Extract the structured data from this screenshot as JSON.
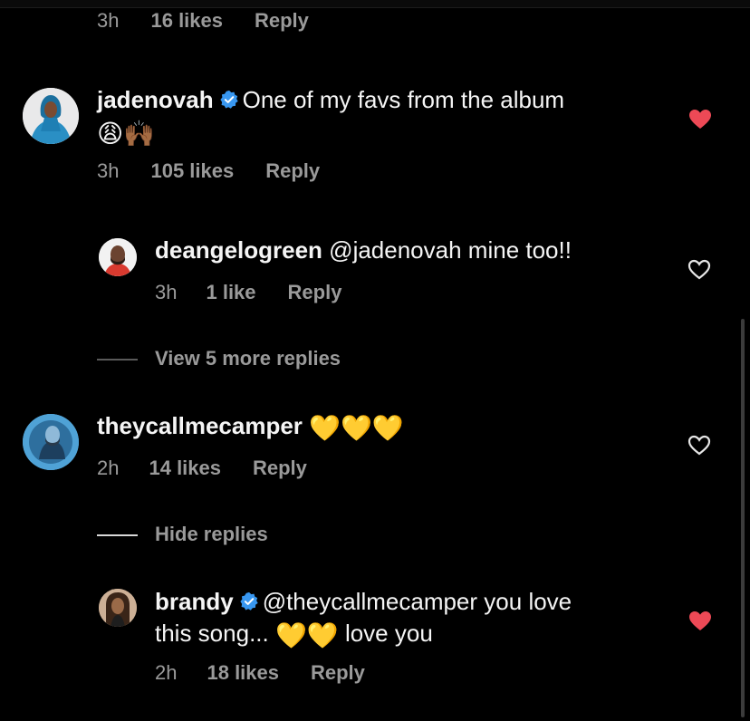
{
  "top": {
    "time": "3h",
    "likes": "16 likes",
    "reply": "Reply"
  },
  "comments": [
    {
      "username": "jadenovah",
      "verified": true,
      "text": "One of my favs from the album",
      "emoji_line": "😩🙌🏾",
      "time": "3h",
      "likes": "105 likes",
      "reply": "Reply",
      "liked": true
    },
    {
      "username": "deangelogreen",
      "mention": "@jadenovah",
      "text": "mine too!!",
      "time": "3h",
      "likes": "1 like",
      "reply": "Reply",
      "liked": false
    },
    {
      "username": "theycallmecamper",
      "text": "💛💛💛",
      "time": "2h",
      "likes": "14 likes",
      "reply": "Reply",
      "liked": false
    },
    {
      "username": "brandy",
      "verified": true,
      "mention": "@theycallmecamper",
      "text_a": "you love",
      "text_b": "this song...",
      "hearts": "💛💛",
      "text_c": "love you",
      "time": "2h",
      "likes": "18 likes",
      "reply": "Reply",
      "liked": true
    }
  ],
  "view_more_replies": "View 5 more replies",
  "hide_replies": "Hide replies",
  "colors": {
    "background": "#000000",
    "text": "#f5f5f5",
    "secondary": "#9a9a9a",
    "liked_heart": "#ed4956",
    "verified": "#3897f0"
  }
}
